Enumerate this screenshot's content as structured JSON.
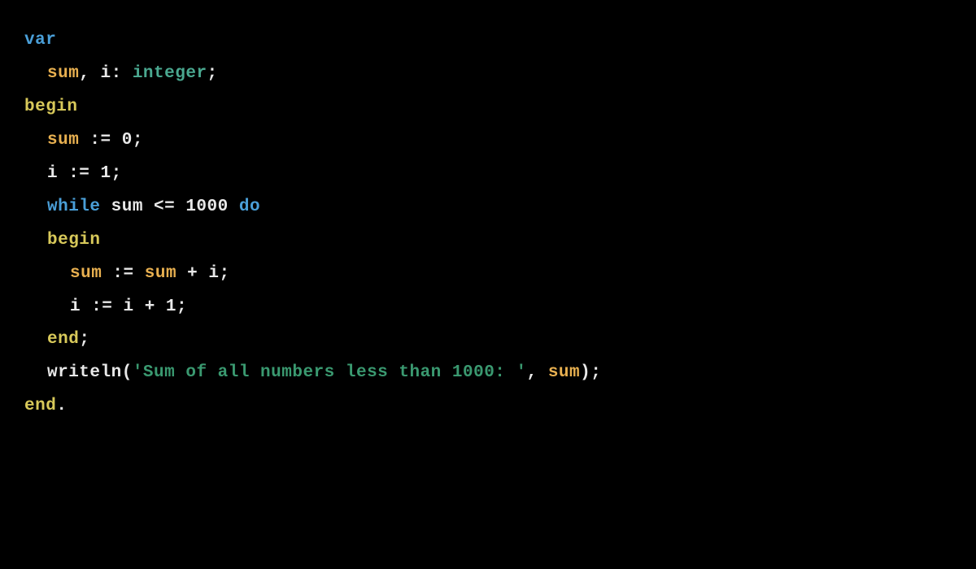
{
  "code": {
    "line1": {
      "var": "var"
    },
    "line2": {
      "sum": "sum",
      "comma_i": ", i: ",
      "integer": "integer",
      "semi": ";"
    },
    "line3": {
      "begin": "begin"
    },
    "line4": {
      "sum": "sum",
      "assign": " := 0;"
    },
    "line5": {
      "text": "i := 1;"
    },
    "line6": {
      "while": "while",
      "mid": " sum <= 1000 ",
      "do": "do"
    },
    "line7": {
      "begin": "begin"
    },
    "line8": {
      "sum1": "sum",
      "mid": " := ",
      "sum2": "sum",
      "rest": " + i;"
    },
    "line9": {
      "text": "i := i + 1;"
    },
    "line10": {
      "end": "end",
      "semi": ";"
    },
    "line11": {
      "writeln": "writeln",
      "open": "(",
      "string": "'Sum of all numbers less than 1000: '",
      "comma": ", ",
      "sum": "sum",
      "close": ");"
    },
    "line12": {
      "end": "end",
      "dot": "."
    }
  }
}
